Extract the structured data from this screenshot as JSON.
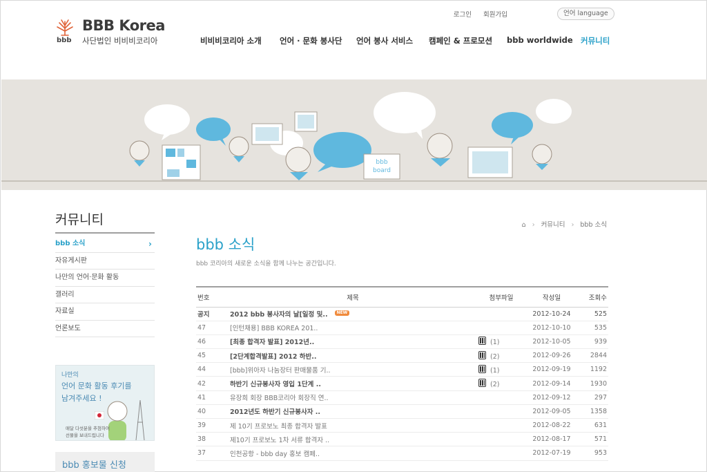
{
  "header": {
    "logo_title": "BBB Korea",
    "logo_sub": "사단법인 비비비코리아",
    "logo_small": "bbb",
    "util": {
      "login": "로그인",
      "join": "회원가입",
      "language": "언어 language"
    },
    "nav": [
      {
        "label": "비비비코리아 소개"
      },
      {
        "label": "언어 · 문화 봉사단"
      },
      {
        "label": "언어 봉사 서비스"
      },
      {
        "label": "캠페인 & 프로모션"
      },
      {
        "label": "bbb worldwide"
      },
      {
        "label": "커뮤니티",
        "active": true
      }
    ]
  },
  "banner": {
    "board_sign": "bbb board"
  },
  "sidebar": {
    "title": "커뮤니티",
    "items": [
      {
        "label": "bbb 소식",
        "active": true
      },
      {
        "label": "자유게시판"
      },
      {
        "label": "나만의 언어·문화 활동"
      },
      {
        "label": "갤러리"
      },
      {
        "label": "자료실"
      },
      {
        "label": "언론보도"
      }
    ],
    "ad1": {
      "line1": "나만의",
      "line2": "언어 문화 활동 후기를",
      "line3": "남겨주세요 !",
      "note1": "매달 다섯분을 추첨하여",
      "note2": "선물을 보내드립니다"
    },
    "ad2": {
      "line1": "bbb 홍보물 신청"
    }
  },
  "breadcrumb": {
    "level1": "커뮤니티",
    "level2": "bbb 소식"
  },
  "page": {
    "title": "bbb 소식",
    "description": "bbb 코리아의 새로운 소식을 함께 나누는 공간입니다."
  },
  "board": {
    "headers": {
      "num": "번호",
      "title": "제목",
      "attach": "첨부파일",
      "date": "작성일",
      "views": "조회수"
    },
    "new_badge": "NEW",
    "rows": [
      {
        "num": "공지",
        "title": "2012 bbb 봉사자의 날[일정 및..",
        "attach": "",
        "date": "2012-10-24",
        "views": "525",
        "notice": true,
        "bold": true,
        "new": true
      },
      {
        "num": "47",
        "title": "[인턴채용] BBB KOREA 201..",
        "attach": "",
        "date": "2012-10-10",
        "views": "535"
      },
      {
        "num": "46",
        "title": "[최종 합격자 발표] 2012년..",
        "attach": "(1)",
        "date": "2012-10-05",
        "views": "939",
        "bold": true
      },
      {
        "num": "45",
        "title": "[2단계합격발표] 2012 하반..",
        "attach": "(2)",
        "date": "2012-09-26",
        "views": "2844",
        "bold": true
      },
      {
        "num": "44",
        "title": "[bbb]위아자 나눔장터 판매물품 기..",
        "attach": "(1)",
        "date": "2012-09-19",
        "views": "1192"
      },
      {
        "num": "42",
        "title": "하반기 신규봉사자 영입 1단계 ..",
        "attach": "(2)",
        "date": "2012-09-14",
        "views": "1930",
        "bold": true
      },
      {
        "num": "41",
        "title": "유장희 회장 BBB코리아 회장직 연..",
        "attach": "",
        "date": "2012-09-12",
        "views": "297"
      },
      {
        "num": "40",
        "title": "2012년도 하반기 신규봉사자 ..",
        "attach": "",
        "date": "2012-09-05",
        "views": "1358",
        "bold": true
      },
      {
        "num": "39",
        "title": "제 10기 프로보노 최종 합격자 발표",
        "attach": "",
        "date": "2012-08-22",
        "views": "631"
      },
      {
        "num": "38",
        "title": "제10기 프로보노 1차 서류 합격자 ..",
        "attach": "",
        "date": "2012-08-17",
        "views": "571"
      },
      {
        "num": "37",
        "title": "인천공항 - bbb day 홍보 캠페..",
        "attach": "",
        "date": "2012-07-19",
        "views": "953"
      }
    ]
  },
  "colors": {
    "accent": "#2aa1c9",
    "badge": "#f08a3c",
    "banner_bg": "#e6e3de",
    "bubble_blue": "#5fb8de"
  }
}
